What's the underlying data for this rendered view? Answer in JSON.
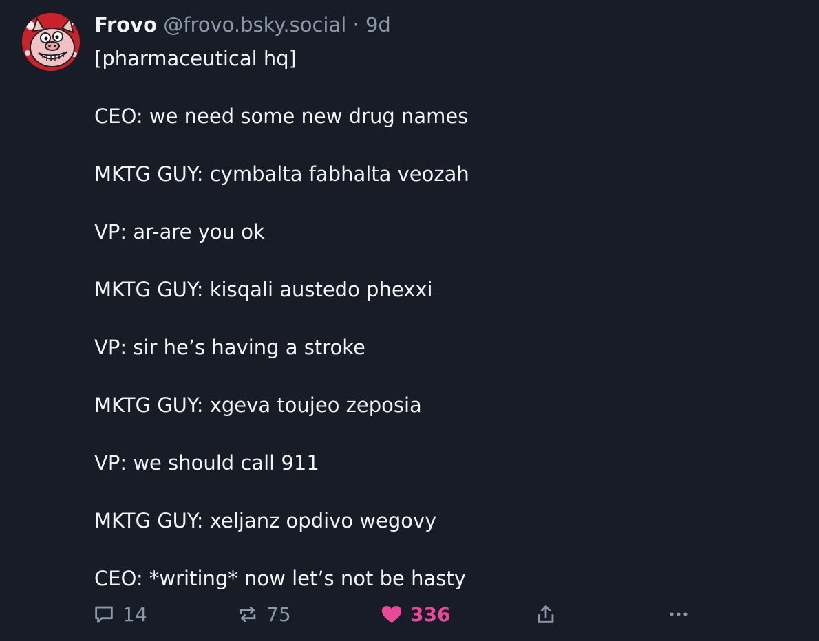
{
  "post": {
    "author_name": "Frovo",
    "handle": "@frovo.bsky.social",
    "separator": "·",
    "time": "9d",
    "lines": [
      "[pharmaceutical hq]",
      "",
      "CEO: we need some new drug names",
      "",
      "MKTG GUY: cymbalta fabhalta veozah",
      "",
      "VP: ar-are you ok",
      "",
      "MKTG GUY: kisqali austedo phexxi",
      "",
      "VP: sir he’s having a stroke",
      "",
      "MKTG GUY: xgeva toujeo zeposia",
      "",
      "VP: we should call 911",
      "",
      "MKTG GUY: xeljanz opdivo wegovy",
      "",
      "CEO: *writing* now let’s not be hasty"
    ]
  },
  "actions": {
    "reply_count": "14",
    "repost_count": "75",
    "like_count": "336",
    "reply_icon": "speech-bubble-icon",
    "repost_icon": "repost-arrows-icon",
    "like_icon": "heart-filled-icon",
    "share_icon": "share-upload-icon",
    "more_icon": "ellipsis-icon"
  },
  "colors": {
    "background": "#171c26",
    "text": "#f1f3f5",
    "muted": "#8b98a9",
    "like_active": "#ec4899"
  }
}
